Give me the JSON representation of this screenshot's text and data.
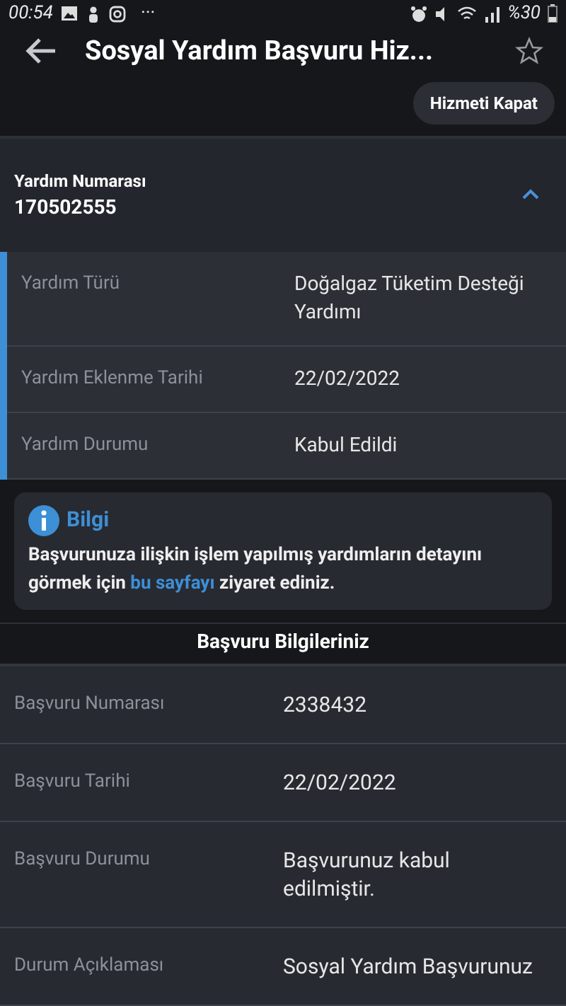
{
  "status_bar": {
    "time": "00:54",
    "more": "···",
    "battery": "%30"
  },
  "header": {
    "title": "Sosyal Yardım Başvuru Hiz...",
    "favorite": false
  },
  "close_service_button": "Hizmeti Kapat",
  "aid": {
    "label": "Yardım Numarası",
    "number": "170502555",
    "expanded": true,
    "rows": [
      {
        "label": "Yardım Türü",
        "value": "Doğalgaz Tüketim Desteği Yardımı"
      },
      {
        "label": "Yardım Eklenme Tarihi",
        "value": "22/02/2022"
      },
      {
        "label": "Yardım Durumu",
        "value": "Kabul Edildi"
      }
    ]
  },
  "info": {
    "title": "Bilgi",
    "text_before": "Başvurunuza ilişkin işlem yapılmış yardımların detayını görmek için",
    "link": "bu sayfayı",
    "text_after": "ziyaret ediniz."
  },
  "application": {
    "title": "Başvuru Bilgileriniz",
    "rows": [
      {
        "label": "Başvuru Numarası",
        "value": "2338432"
      },
      {
        "label": "Başvuru Tarihi",
        "value": "22/02/2022"
      },
      {
        "label": "Başvuru Durumu",
        "value": "Başvurunuz kabul edilmiştir."
      },
      {
        "label": "Durum Açıklaması",
        "value": "Sosyal Yardım Başvurunuz"
      }
    ]
  }
}
